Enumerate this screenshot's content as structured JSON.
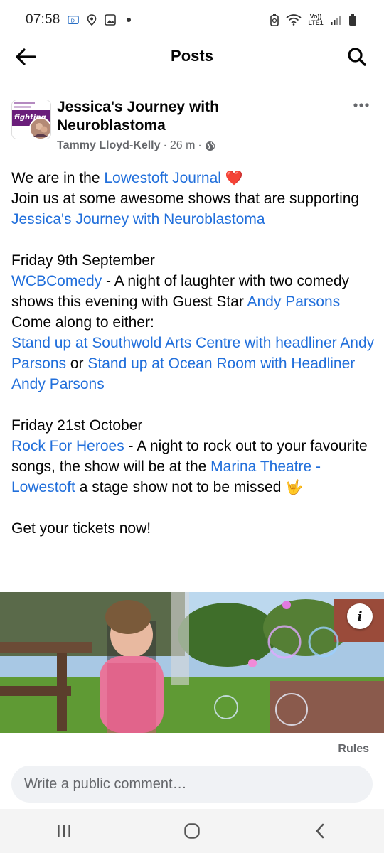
{
  "status_bar": {
    "time": "07:58",
    "network_label": "Vo)) LTE1",
    "left_icons": [
      "screen-mirror-icon",
      "location-icon",
      "image-icon",
      "dot-icon"
    ],
    "right_icons": [
      "battery-saver-icon",
      "wifi-icon",
      "signal-icon",
      "battery-icon"
    ]
  },
  "header": {
    "title": "Posts",
    "back_icon": "arrow-left-icon",
    "search_icon": "search-icon"
  },
  "post": {
    "page_name": "Jessica's Journey with Neuroblastoma",
    "author": "Tammy Lloyd-Kelly",
    "time": "26 m",
    "privacy_icon": "globe-icon",
    "more_icon": "more-dots-icon",
    "avatar_text": "fighting"
  },
  "body": {
    "l1_text": "We are in the ",
    "l1_link": "Lowestoft Journal",
    "l1_emoji": "❤️",
    "l2_text": "Join us at some awesome shows that are supporting ",
    "l2_link": "Jessica's Journey with Neuroblastoma",
    "date1": "Friday 9th September",
    "ev1_link": "WCBComedy",
    "ev1_text": " - A night of laughter with two comedy shows this evening with Guest Star ",
    "ev1_link2": "Andy Parsons",
    "come_along": "Come along to either:",
    "opt1_link": "Stand up at Southwold Arts Centre with headliner Andy Parsons",
    "or_text": " or ",
    "opt2_link": "Stand up at Ocean Room with Headliner Andy Parsons",
    "date2": "Friday 21st October",
    "ev2_link": "Rock For Heroes",
    "ev2_text": " - A night to rock out to your favourite songs, the show will be at the ",
    "ev2_link2": "Marina Theatre - Lowestoft",
    "ev2_text2": " a stage show not to be missed ",
    "ev2_emoji": "🤟",
    "closing": "Get your tickets now!"
  },
  "image": {
    "info_label": "i"
  },
  "comments": {
    "rules_label": "Rules",
    "placeholder": "Write a public comment…"
  },
  "nav": {
    "recent_icon": "recent-apps-icon",
    "home_icon": "home-icon",
    "back_icon": "back-chevron-icon"
  },
  "colors": {
    "link": "#216fdb",
    "meta": "#65676b",
    "heart": "#e41e3f"
  }
}
